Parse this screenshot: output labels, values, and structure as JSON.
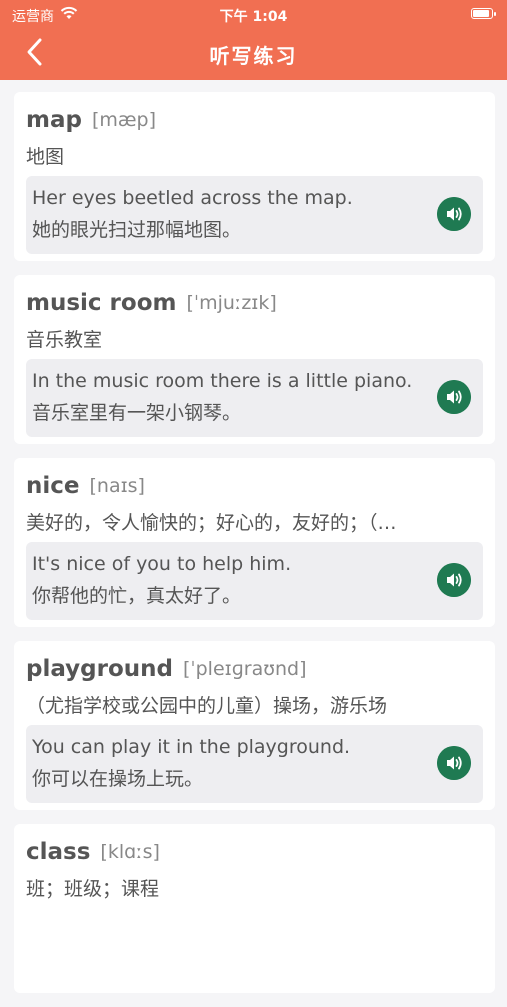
{
  "status": {
    "carrier": "运营商",
    "time": "下午 1:04"
  },
  "nav": {
    "title": "听写练习"
  },
  "cards": [
    {
      "word": "map",
      "phonetic": "[mæp]",
      "meaning": "地图",
      "sentence": "Her eyes beetled across the map.",
      "translation": "她的眼光扫过那幅地图。"
    },
    {
      "word": "music room",
      "phonetic": "[ˈmjuːzɪk]",
      "meaning": "音乐教室",
      "sentence": "In the music room there is a little piano.",
      "translation": "音乐室里有一架小钢琴。"
    },
    {
      "word": "nice",
      "phonetic": "[naɪs]",
      "meaning": "美好的，令人愉快的；好心的，友好的；（…",
      "sentence": "It's nice of you to help him.",
      "translation": "你帮他的忙，真太好了。"
    },
    {
      "word": "playground",
      "phonetic": "[ˈpleɪɡraʊnd]",
      "meaning": "（尤指学校或公园中的儿童）操场，游乐场",
      "sentence": "You can play it in the playground.",
      "translation": "你可以在操场上玩。"
    },
    {
      "word": "class",
      "phonetic": "[klɑːs]",
      "meaning": "班；班级；课程",
      "sentence": "",
      "translation": ""
    }
  ]
}
